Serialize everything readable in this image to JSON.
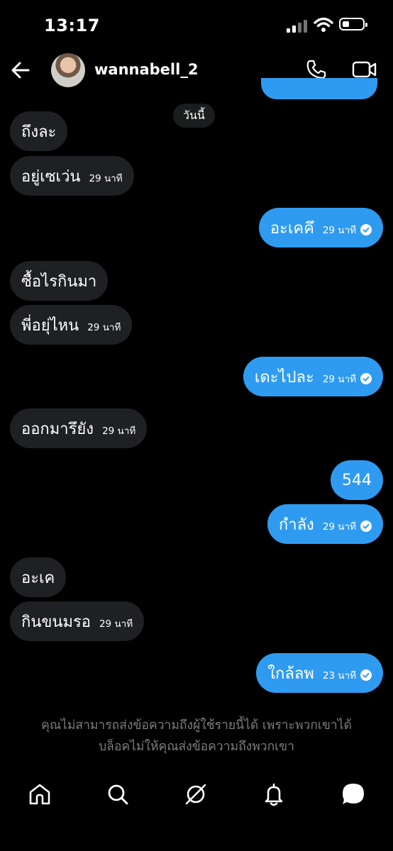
{
  "status_bar": {
    "time": "13:17"
  },
  "header": {
    "username": "wannabell_2"
  },
  "day_label": "วันนี้",
  "messages": [
    {
      "side": "in",
      "text": "ถึงละ",
      "time": ""
    },
    {
      "side": "in",
      "text": "อยู่เซเว่น",
      "time": "29 นาที"
    },
    {
      "side": "out",
      "text": "อะเคคึ",
      "time": "29 นาที"
    },
    {
      "side": "in",
      "text": "ซื้อไรกินมา",
      "time": ""
    },
    {
      "side": "in",
      "text": "พี่อยุ่ไหน",
      "time": "29 นาที"
    },
    {
      "side": "out",
      "text": "เดะไปละ",
      "time": "29 นาที"
    },
    {
      "side": "in",
      "text": "ออกมารึยัง",
      "time": "29 นาที"
    },
    {
      "side": "out",
      "text": "544",
      "time": ""
    },
    {
      "side": "out",
      "text": "กำลัง",
      "time": "29 นาที"
    },
    {
      "side": "in",
      "text": "อะเค",
      "time": ""
    },
    {
      "side": "in",
      "text": "กินขนมรอ",
      "time": "29 นาที"
    },
    {
      "side": "out",
      "text": "ใกล้ลพ",
      "time": "23 นาที"
    }
  ],
  "notice": {
    "line1": "คุณไม่สามารถส่งข้อความถึงผู้ใช้รายนี้ได้ เพราะพวกเขาได้",
    "line2": "บล็อคไม่ให้คุณส่งข้อความถึงพวกเขา"
  },
  "colors": {
    "background": "#000000",
    "outgoing_bubble": "#2f9bf0",
    "incoming_bubble": "#1f2023",
    "notice_text": "#7c7d80"
  },
  "icons": {
    "header": [
      "back-arrow-icon",
      "phone-icon",
      "video-camera-icon"
    ],
    "bottom_nav": [
      "home-icon",
      "search-icon",
      "explore-icon",
      "notifications-bell-icon",
      "messages-icon"
    ]
  }
}
